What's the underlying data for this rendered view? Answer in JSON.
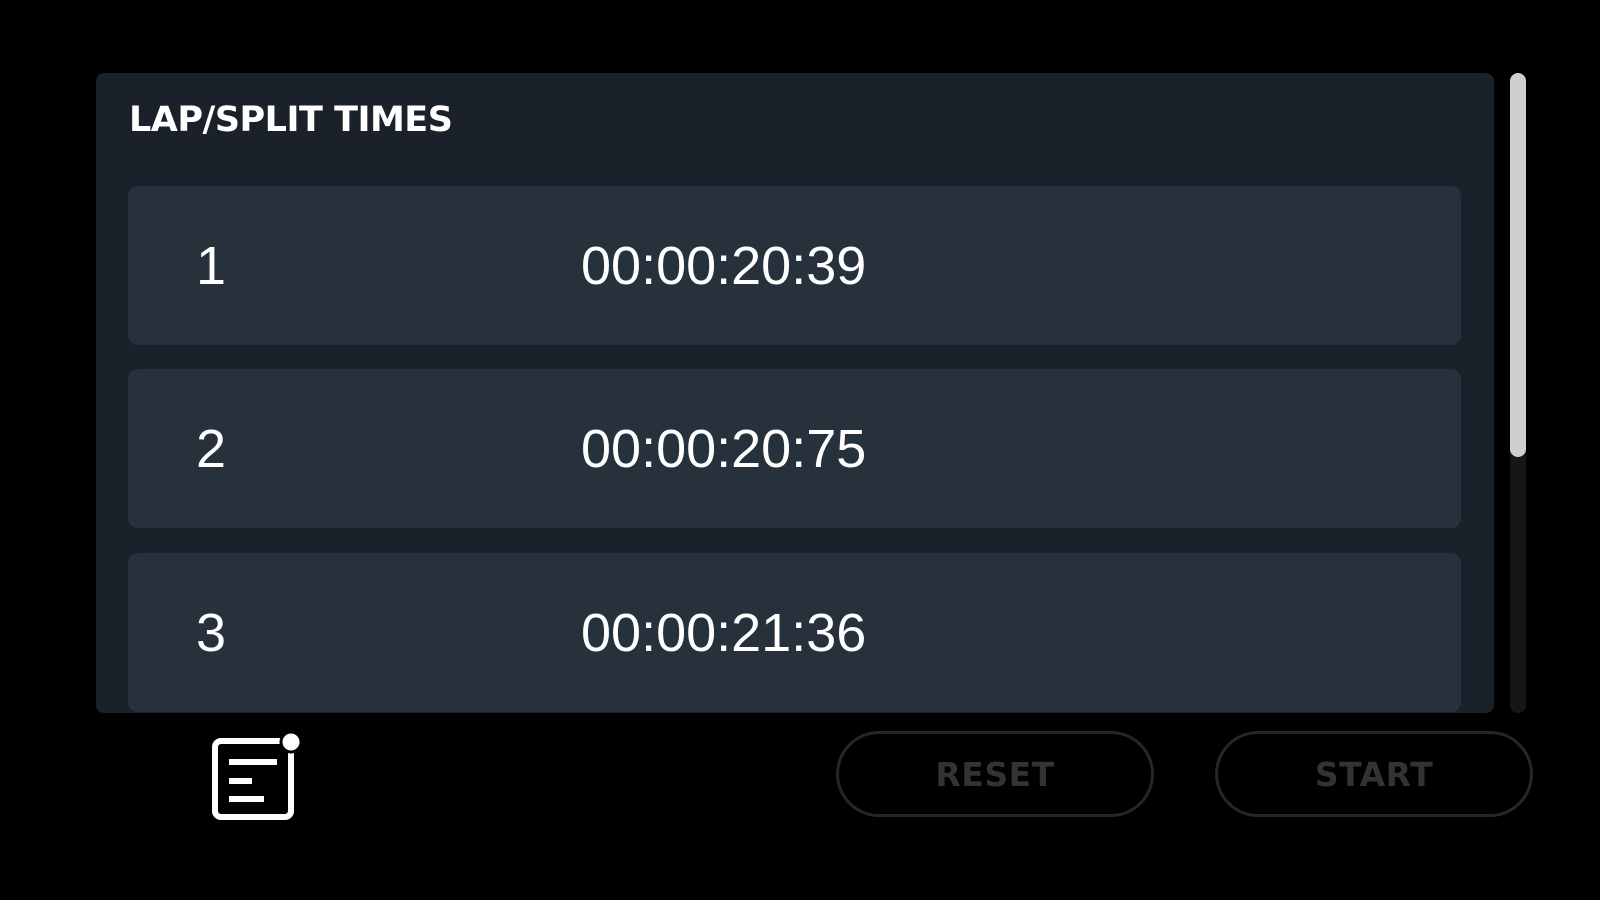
{
  "laps": {
    "title": "LAP/SPLIT TIMES",
    "rows": [
      {
        "number": "1",
        "time": "00:00:20:39"
      },
      {
        "number": "2",
        "time": "00:00:20:75"
      },
      {
        "number": "3",
        "time": "00:00:21:36"
      }
    ]
  },
  "scrollbar": {
    "visible_fraction": 0.6
  },
  "controls": {
    "log_icon": "lap-log-icon",
    "reset_label": "RESET",
    "start_label": "START"
  },
  "colors": {
    "background": "#000000",
    "panel": "#1b212b",
    "row": "#27313c",
    "text": "#ffffff",
    "disabled_text": "#333333"
  }
}
